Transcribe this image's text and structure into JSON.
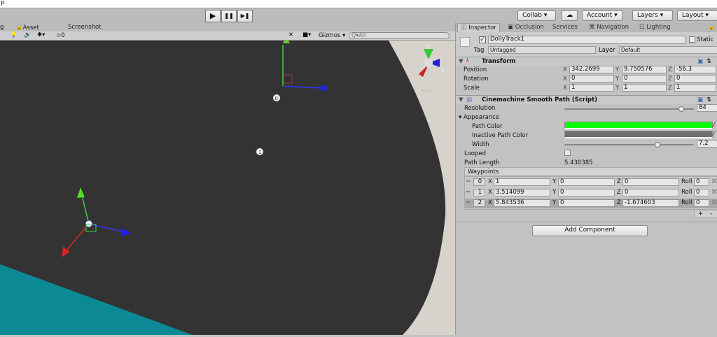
{
  "title_fragment": "p",
  "toolbar": {
    "play": "▶",
    "pause": "❚❚",
    "step": "▶❚",
    "collab": "Collab ▾",
    "account": "Account",
    "layers": "Layers",
    "layout": "Layout"
  },
  "scene_tabs": {
    "left_cut": "g",
    "asset_store": "Asset Store",
    "screenshot": "Screenshot"
  },
  "scene_bar": {
    "hidden_count": "0",
    "gizmos": "Gizmos",
    "search_placeholder": "All"
  },
  "scene": {
    "gizmo_y": "y",
    "gizmo_x": "x",
    "gizmo_label": "Persp",
    "waypoint_0": "0",
    "waypoint_1": "1",
    "colors": {
      "background": "#333333",
      "cyan": "#0b8a96",
      "sky": "#d7d3cc"
    }
  },
  "inspector": {
    "tabs": [
      "Inspector",
      "Occlusion",
      "Services",
      "Navigation",
      "Lighting"
    ],
    "object_name": "DollyTrack1",
    "active": true,
    "static_label": "Static",
    "tag_label": "Tag",
    "tag_value": "Untagged",
    "layer_label": "Layer",
    "layer_value": "Default",
    "transform": {
      "title": "Transform",
      "rows": [
        {
          "label": "Position",
          "x": "342.2699",
          "y": "9.750576",
          "z": "-56.3"
        },
        {
          "label": "Rotation",
          "x": "0",
          "y": "0",
          "z": "0"
        },
        {
          "label": "Scale",
          "x": "1",
          "y": "1",
          "z": "1"
        }
      ]
    },
    "path": {
      "title": "Cinemachine Smooth Path (Script)",
      "resolution_label": "Resolution",
      "resolution": "84",
      "resolution_fraction": 0.9,
      "appearance": "Appearance",
      "path_color_label": "Path Color",
      "path_color": "#00ff00",
      "inactive_color_label": "Inactive Path Color",
      "inactive_color": "#6e6e6e",
      "width_label": "Width",
      "width": "7.2",
      "width_fraction": 0.72,
      "looped_label": "Looped",
      "looped": false,
      "length_label": "Path Length",
      "length": "5.430385",
      "waypoints_label": "Waypoints",
      "waypoints": [
        {
          "i": "0",
          "x": "1",
          "y": "0",
          "z": "0",
          "roll": "0"
        },
        {
          "i": "1",
          "x": "3.514099",
          "y": "0",
          "z": "0",
          "roll": "0"
        },
        {
          "i": "2",
          "x": "5.843536",
          "y": "0",
          "z": "-1.674603",
          "roll": "0"
        }
      ],
      "add": "+",
      "remove": "-"
    },
    "add_component": "Add Component"
  }
}
